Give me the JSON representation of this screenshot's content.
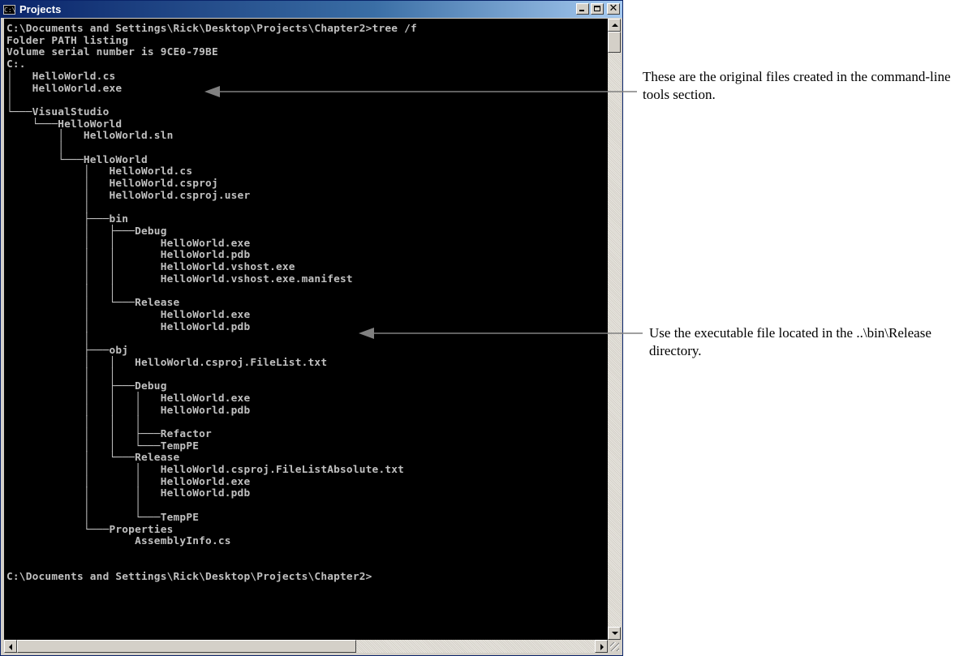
{
  "window": {
    "title": "Projects",
    "icon": "console-icon",
    "buttons": [
      "minimize-icon",
      "maximize-icon",
      "close-icon"
    ]
  },
  "console": {
    "lines": [
      "C:\\Documents and Settings\\Rick\\Desktop\\Projects\\Chapter2>tree /f",
      "Folder PATH listing",
      "Volume serial number is 9CE0-79BE",
      "C:.",
      "│   HelloWorld.cs",
      "│   HelloWorld.exe",
      "│",
      "└───VisualStudio",
      "    └───HelloWorld",
      "        │   HelloWorld.sln",
      "        │",
      "        └───HelloWorld",
      "            │   HelloWorld.cs",
      "            │   HelloWorld.csproj",
      "            │   HelloWorld.csproj.user",
      "            │",
      "            ├───bin",
      "            │   ├───Debug",
      "            │   │       HelloWorld.exe",
      "            │   │       HelloWorld.pdb",
      "            │   │       HelloWorld.vshost.exe",
      "            │   │       HelloWorld.vshost.exe.manifest",
      "            │   │",
      "            │   └───Release",
      "            │           HelloWorld.exe",
      "            │           HelloWorld.pdb",
      "            │",
      "            ├───obj",
      "            │   │   HelloWorld.csproj.FileList.txt",
      "            │   │",
      "            │   ├───Debug",
      "            │   │   │   HelloWorld.exe",
      "            │   │   │   HelloWorld.pdb",
      "            │   │   │",
      "            │   │   ├───Refactor",
      "            │   │   └───TempPE",
      "            │   └───Release",
      "            │       │   HelloWorld.csproj.FileListAbsolute.txt",
      "            │       │   HelloWorld.exe",
      "            │       │   HelloWorld.pdb",
      "            │       │",
      "            │       └───TempPE",
      "            └───Properties",
      "                    AssemblyInfo.cs",
      "",
      "",
      "C:\\Documents and Settings\\Rick\\Desktop\\Projects\\Chapter2>"
    ]
  },
  "annotations": [
    {
      "text": "These are the original files created in the command-line tools section."
    },
    {
      "text": "Use the executable file located in the ..\\bin\\Release directory."
    }
  ],
  "colors": {
    "console_bg": "#000000",
    "console_fg": "#c0c0c0",
    "title_bar": "#0a246a",
    "arrow": "#808080"
  }
}
